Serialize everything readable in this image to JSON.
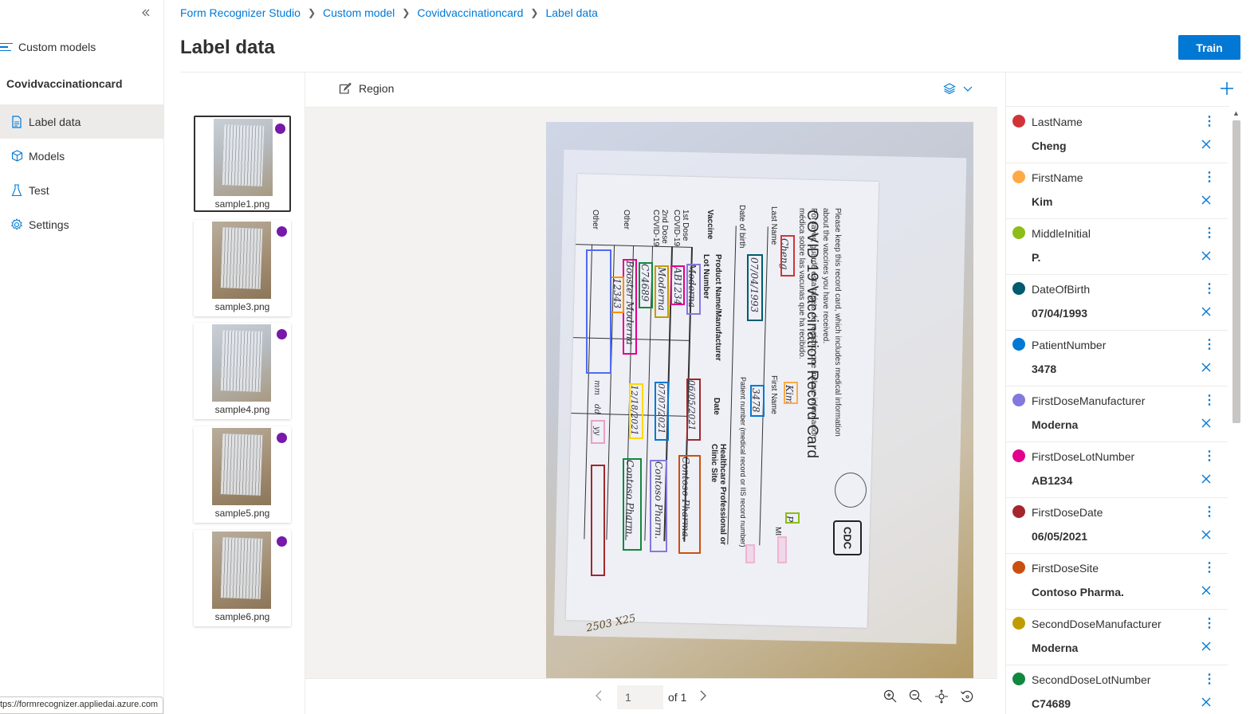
{
  "nav": {
    "collapse_icon": "double-chevron-left-icon",
    "custom_models_label": "Custom models",
    "project_name": "Covidvaccinationcard",
    "items": [
      {
        "label": "Label data",
        "icon": "document-icon",
        "active": true
      },
      {
        "label": "Models",
        "icon": "cube-icon",
        "active": false
      },
      {
        "label": "Test",
        "icon": "beaker-icon",
        "active": false
      },
      {
        "label": "Settings",
        "icon": "gear-icon",
        "active": false
      }
    ],
    "status_url": "tps://formrecognizer.appliedai.azure.com"
  },
  "header": {
    "breadcrumb": [
      "Form Recognizer Studio",
      "Custom model",
      "Covidvaccinationcard",
      "Label data"
    ],
    "title": "Label data",
    "train_label": "Train"
  },
  "thumbnails": [
    {
      "name": "sample1.png",
      "selected": true
    },
    {
      "name": "sample3.png",
      "selected": false
    },
    {
      "name": "sample4.png",
      "selected": false
    },
    {
      "name": "sample5.png",
      "selected": false
    },
    {
      "name": "sample6.png",
      "selected": false
    }
  ],
  "viewer": {
    "region_label": "Region",
    "page_value": "1",
    "page_of": "of 1",
    "document": {
      "title": "COVID-19 Vaccination Record Card",
      "subtitle1": "Please keep this record card, which includes medical information",
      "subtitle2": "about the vaccines you have received.",
      "subtitle3": "Por favor, guarde esta tarjeta de registro, que incluye información",
      "subtitle4": "médica sobre las vacunas que ha recibido.",
      "last_name_label": "Last Name",
      "first_name_label": "First Name",
      "mi_label": "MI",
      "dob_label": "Date of birth",
      "patient_label": "Patient number (medical record or IIS record number)",
      "vaccine_label": "Vaccine",
      "product_label": "Product Name/Manufacturer",
      "lot_label": "Lot Number",
      "date_label": "Date",
      "hcp_label": "Healthcare Professional or Clinic Site",
      "dose1_label": "1st Dose COVID-19",
      "dose2_label": "2nd Dose COVID-19",
      "other1_label": "Other",
      "other2_label": "Other",
      "logo_text": "CDC",
      "hw_last": "Cheng",
      "hw_first": "Kim",
      "hw_mi": "P",
      "hw_dob": "07/04/1993",
      "hw_patient": "3478",
      "hw_d1_mfr": "Moderna",
      "hw_d1_lot": "AB1234",
      "hw_d1_date": "06/05/2021",
      "hw_d1_site": "Contoso Pharma.",
      "hw_d2_mfr": "Moderna",
      "hw_d2_lot": "C74689",
      "hw_d2_date": "07/07/2021",
      "hw_d2_site": "Contoso Pharm.",
      "hw_booster": "Booster Moderna",
      "hw_booster_lot": "12343",
      "hw_booster_date": "12/18/2021",
      "hw_booster_site": "Contoso Pharm.",
      "hw_mm": "mm",
      "hw_dd": "dd",
      "hw_yy": "yy",
      "hw_bottom": "2503  X25"
    }
  },
  "fields": [
    {
      "name": "LastName",
      "value": "Cheng",
      "color": "#d13438"
    },
    {
      "name": "FirstName",
      "value": "Kim",
      "color": "#ffaa44"
    },
    {
      "name": "MiddleInitial",
      "value": "P.",
      "color": "#8cbd18"
    },
    {
      "name": "DateOfBirth",
      "value": "07/04/1993",
      "color": "#005b70"
    },
    {
      "name": "PatientNumber",
      "value": "3478",
      "color": "#0078d4"
    },
    {
      "name": "FirstDoseManufacturer",
      "value": "Moderna",
      "color": "#8378de"
    },
    {
      "name": "FirstDoseLotNumber",
      "value": "AB1234",
      "color": "#e3008c"
    },
    {
      "name": "FirstDoseDate",
      "value": "06/05/2021",
      "color": "#a4262c"
    },
    {
      "name": "FirstDoseSite",
      "value": "Contoso Pharma.",
      "color": "#ca5010"
    },
    {
      "name": "SecondDoseManufacturer",
      "value": "Moderna",
      "color": "#c19c00"
    },
    {
      "name": "SecondDoseLotNumber",
      "value": "C74689",
      "color": "#10893e"
    }
  ],
  "colors": {
    "accent": "#0078d4",
    "thumbnail_dot": "#7719aa"
  }
}
